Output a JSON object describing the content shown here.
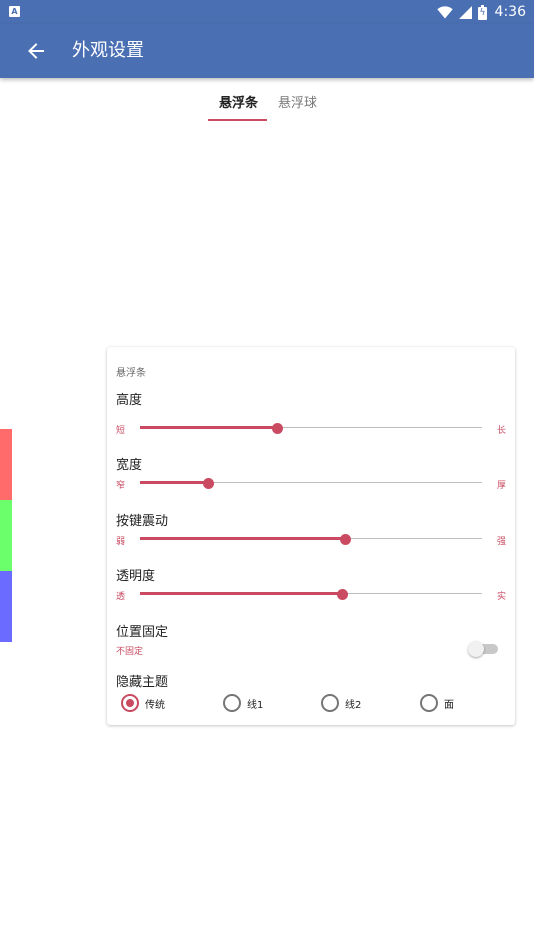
{
  "status_bar": {
    "notification_icon": "A",
    "time": "4:36",
    "icons": [
      "wifi-icon",
      "signal-icon",
      "battery-charging-icon"
    ]
  },
  "app_bar": {
    "back_icon": "arrow-left-icon",
    "title": "外观设置"
  },
  "tabs": [
    {
      "label": "悬浮条",
      "active": true
    },
    {
      "label": "悬浮球",
      "active": false
    }
  ],
  "color_strip": {
    "colors": [
      "#ff6b6b",
      "#6bff6b",
      "#6b6bff"
    ]
  },
  "card": {
    "title": "悬浮条",
    "sliders": [
      {
        "label": "高度",
        "min_label": "短",
        "max_label": "长",
        "value": 0.4
      },
      {
        "label": "宽度",
        "min_label": "窄",
        "max_label": "厚",
        "value": 0.2
      },
      {
        "label": "按键震动",
        "min_label": "弱",
        "max_label": "强",
        "value": 0.6
      },
      {
        "label": "透明度",
        "min_label": "透",
        "max_label": "实",
        "value": 0.59
      }
    ],
    "position_lock": {
      "label": "位置固定",
      "state_text": "不固定",
      "enabled": false
    },
    "theme": {
      "label": "隐藏主题",
      "options": [
        {
          "label": "传统",
          "checked": true
        },
        {
          "label": "线1",
          "checked": false
        },
        {
          "label": "线2",
          "checked": false
        },
        {
          "label": "面",
          "checked": false
        }
      ]
    }
  },
  "colors": {
    "primary": "#4a6fb3",
    "accent": "#c94a61"
  }
}
